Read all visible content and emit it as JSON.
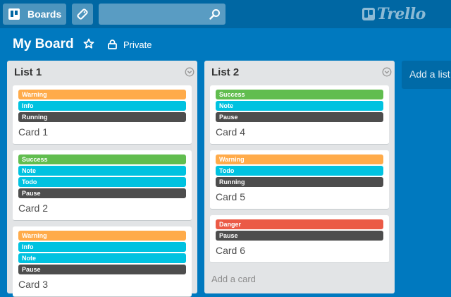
{
  "header": {
    "boards_label": "Boards",
    "search_value": "",
    "logo_text": "Trello"
  },
  "board": {
    "title": "My Board",
    "privacy": "Private"
  },
  "lists": [
    {
      "title": "List 1",
      "cards": [
        {
          "title": "Card 1",
          "labels": [
            {
              "text": "Warning",
              "color": "#ffab4a"
            },
            {
              "text": "Info",
              "color": "#00c2e0"
            },
            {
              "text": "Running",
              "color": "#4d4d4d"
            }
          ]
        },
        {
          "title": "Card 2",
          "labels": [
            {
              "text": "Success",
              "color": "#61bd4f"
            },
            {
              "text": "Note",
              "color": "#00c2e0"
            },
            {
              "text": "Todo",
              "color": "#00c2e0"
            },
            {
              "text": "Pause",
              "color": "#4d4d4d"
            }
          ]
        },
        {
          "title": "Card 3",
          "labels": [
            {
              "text": "Warning",
              "color": "#ffab4a"
            },
            {
              "text": "Info",
              "color": "#00c2e0"
            },
            {
              "text": "Note",
              "color": "#00c2e0"
            },
            {
              "text": "Pause",
              "color": "#4d4d4d"
            }
          ]
        }
      ]
    },
    {
      "title": "List 2",
      "cards": [
        {
          "title": "Card 4",
          "labels": [
            {
              "text": "Success",
              "color": "#61bd4f"
            },
            {
              "text": "Note",
              "color": "#00c2e0"
            },
            {
              "text": "Pause",
              "color": "#4d4d4d"
            }
          ]
        },
        {
          "title": "Card 5",
          "labels": [
            {
              "text": "Warning",
              "color": "#ffab4a"
            },
            {
              "text": "Todo",
              "color": "#00c2e0"
            },
            {
              "text": "Running",
              "color": "#4d4d4d"
            }
          ]
        },
        {
          "title": "Card 6",
          "labels": [
            {
              "text": "Danger",
              "color": "#eb5a46"
            },
            {
              "text": "Pause",
              "color": "#4d4d4d"
            }
          ]
        }
      ],
      "add_card": "Add a card"
    }
  ],
  "add_list": "Add a list",
  "icons": {
    "boards": "boards-icon",
    "tag": "tag-icon",
    "search": "search-icon",
    "star": "star-icon",
    "lock": "lock-icon",
    "list_menu": "chevron-down-icon",
    "logo": "trello-logo-icon"
  },
  "colors": {
    "background": "#0079bf",
    "topbar": "#0067a3",
    "list": "#e2e4e6"
  }
}
